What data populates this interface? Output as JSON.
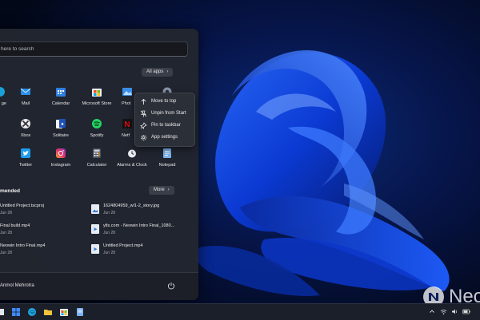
{
  "start_menu": {
    "search_placeholder": "here to search",
    "pinned": {
      "all_apps_label": "All apps",
      "apps": [
        {
          "label": "ge",
          "icon": "edge-icon"
        },
        {
          "label": "Mail",
          "icon": "mail-icon"
        },
        {
          "label": "Calendar",
          "icon": "calendar-icon"
        },
        {
          "label": "Microsoft Store",
          "icon": "store-icon"
        },
        {
          "label": "Phot",
          "icon": "photos-icon"
        },
        {
          "label": "",
          "icon": "settings-icon"
        },
        {
          "label": "",
          "icon": "app-icon"
        },
        {
          "label": "Xbox",
          "icon": "xbox-icon"
        },
        {
          "label": "Solitaire",
          "icon": "solitaire-icon"
        },
        {
          "label": "Spotify",
          "icon": "spotify-icon"
        },
        {
          "label": "Netf",
          "icon": "netflix-icon"
        },
        {
          "label": "",
          "icon": "app-icon"
        },
        {
          "label": "Twitter",
          "icon": "twitter-icon"
        },
        {
          "label": "Instagram",
          "icon": "instagram-icon"
        },
        {
          "label": "Calculator",
          "icon": "calculator-icon"
        },
        {
          "label": "Alarms & Clock",
          "icon": "alarm-clock-icon"
        },
        {
          "label": "Notepad",
          "icon": "notepad-icon"
        }
      ]
    },
    "recommended": {
      "title": "mended",
      "more_label": "More",
      "items": [
        {
          "name": "Untitled Project.tscproj",
          "date": "Jun 28",
          "icon": "project-file-icon"
        },
        {
          "name": "1624804959_wl1-2_story.jpg",
          "date": "Jun 28",
          "icon": "image-file-icon"
        },
        {
          "name": "Final build.mp4",
          "date": "Jun 28",
          "icon": "video-file-icon"
        },
        {
          "name": "ytls.com - Neowin Intro Final_1080...",
          "date": "Jun 28",
          "icon": "video-file-icon"
        },
        {
          "name": "Neowin Intro Final.mp4",
          "date": "Jun 28",
          "icon": "video-file-icon"
        },
        {
          "name": "Untitled Project.mp4",
          "date": "Jun 28",
          "icon": "video-file-icon"
        }
      ]
    },
    "user_name": "Anmol Mehrotra"
  },
  "context_menu": {
    "items": [
      {
        "label": "Move to top",
        "icon": "arrow-up-icon"
      },
      {
        "label": "Unpin from Start",
        "icon": "unpin-icon"
      },
      {
        "label": "Pin to taskbar",
        "icon": "pin-icon"
      },
      {
        "label": "App settings",
        "icon": "gear-icon"
      }
    ]
  },
  "watermark": {
    "text": "Neo"
  },
  "colors": {
    "accent": "#1f5cff",
    "menu_bg": "#22262f",
    "taskbar_bg": "#1b1f2a"
  }
}
